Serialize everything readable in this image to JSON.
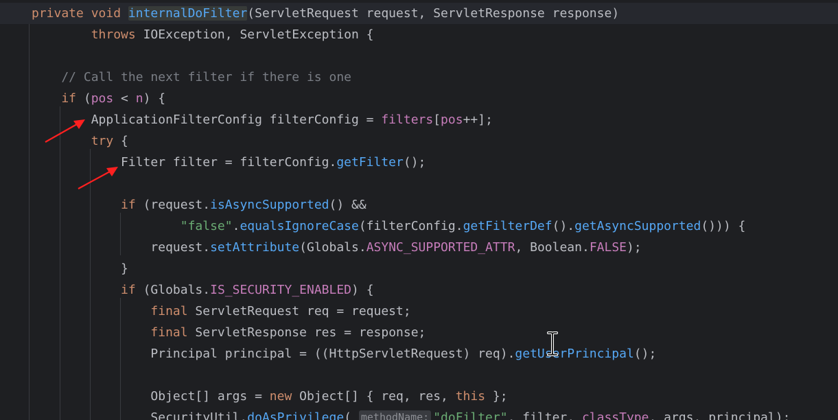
{
  "editor": {
    "lines": [
      {
        "id": "l1",
        "tokens": [
          {
            "t": "private void ",
            "c": "kw"
          },
          {
            "t": "internalDoFilter",
            "c": "fn hl-name"
          },
          {
            "t": "(ServletRequest ",
            "c": "ty"
          },
          {
            "t": "request",
            "c": "par"
          },
          {
            "t": ", ServletResponse ",
            "c": "ty"
          },
          {
            "t": "response",
            "c": "par"
          },
          {
            "t": ")",
            "c": "ty"
          }
        ]
      },
      {
        "id": "l2",
        "tokens": [
          {
            "t": "        throws ",
            "c": "kw"
          },
          {
            "t": "IOException, ServletException {",
            "c": "ty"
          }
        ]
      },
      {
        "id": "l3",
        "tokens": []
      },
      {
        "id": "l4",
        "tokens": [
          {
            "t": "    // Call the next filter if there is one",
            "c": "cm"
          }
        ]
      },
      {
        "id": "l5",
        "tokens": [
          {
            "t": "    if ",
            "c": "kw"
          },
          {
            "t": "(",
            "c": "ty"
          },
          {
            "t": "pos",
            "c": "pr"
          },
          {
            "t": " < ",
            "c": "ty"
          },
          {
            "t": "n",
            "c": "pr"
          },
          {
            "t": ") {",
            "c": "ty"
          }
        ]
      },
      {
        "id": "l6",
        "tokens": [
          {
            "t": "        ApplicationFilterConfig filterConfig = ",
            "c": "ty"
          },
          {
            "t": "filters",
            "c": "pr"
          },
          {
            "t": "[",
            "c": "ty"
          },
          {
            "t": "pos",
            "c": "pr"
          },
          {
            "t": "++];",
            "c": "ty"
          }
        ]
      },
      {
        "id": "l7",
        "tokens": [
          {
            "t": "        try ",
            "c": "kw"
          },
          {
            "t": "{",
            "c": "ty"
          }
        ]
      },
      {
        "id": "l8",
        "tokens": [
          {
            "t": "            Filter filter = filterConfig.",
            "c": "ty"
          },
          {
            "t": "getFilter",
            "c": "fn"
          },
          {
            "t": "();",
            "c": "ty"
          }
        ]
      },
      {
        "id": "l9",
        "tokens": []
      },
      {
        "id": "l10",
        "tokens": [
          {
            "t": "            if ",
            "c": "kw"
          },
          {
            "t": "(",
            "c": "ty"
          },
          {
            "t": "request",
            "c": "par"
          },
          {
            "t": ".",
            "c": "ty"
          },
          {
            "t": "isAsyncSupported",
            "c": "fn"
          },
          {
            "t": "() &&",
            "c": "ty"
          }
        ]
      },
      {
        "id": "l11",
        "tokens": [
          {
            "t": "                    ",
            "c": "ty"
          },
          {
            "t": "\"false\"",
            "c": "str"
          },
          {
            "t": ".",
            "c": "ty"
          },
          {
            "t": "equalsIgnoreCase",
            "c": "fn"
          },
          {
            "t": "(filterConfig.",
            "c": "ty"
          },
          {
            "t": "getFilterDef",
            "c": "fn"
          },
          {
            "t": "().",
            "c": "ty"
          },
          {
            "t": "getAsyncSupported",
            "c": "fn"
          },
          {
            "t": "())) {",
            "c": "ty"
          }
        ]
      },
      {
        "id": "l12",
        "tokens": [
          {
            "t": "                ",
            "c": "ty"
          },
          {
            "t": "request",
            "c": "par"
          },
          {
            "t": ".",
            "c": "ty"
          },
          {
            "t": "setAttribute",
            "c": "fn"
          },
          {
            "t": "(Globals.",
            "c": "ty"
          },
          {
            "t": "ASYNC_SUPPORTED_ATTR",
            "c": "pr"
          },
          {
            "t": ", Boolean.",
            "c": "ty"
          },
          {
            "t": "FALSE",
            "c": "pr"
          },
          {
            "t": ");",
            "c": "ty"
          }
        ]
      },
      {
        "id": "l13",
        "tokens": [
          {
            "t": "            }",
            "c": "ty"
          }
        ]
      },
      {
        "id": "l14",
        "tokens": [
          {
            "t": "            if ",
            "c": "kw"
          },
          {
            "t": "(Globals.",
            "c": "ty"
          },
          {
            "t": "IS_SECURITY_ENABLED",
            "c": "pr"
          },
          {
            "t": ") {",
            "c": "ty"
          }
        ]
      },
      {
        "id": "l15",
        "tokens": [
          {
            "t": "                final ",
            "c": "kw"
          },
          {
            "t": "ServletRequest req = ",
            "c": "ty"
          },
          {
            "t": "request",
            "c": "par"
          },
          {
            "t": ";",
            "c": "ty"
          }
        ]
      },
      {
        "id": "l16",
        "tokens": [
          {
            "t": "                final ",
            "c": "kw"
          },
          {
            "t": "ServletResponse res = ",
            "c": "ty"
          },
          {
            "t": "response",
            "c": "par"
          },
          {
            "t": ";",
            "c": "ty"
          }
        ]
      },
      {
        "id": "l17",
        "tokens": [
          {
            "t": "                Principal principal = ((HttpServletRequest) req).",
            "c": "ty"
          },
          {
            "t": "getUserPrincipal",
            "c": "fn"
          },
          {
            "t": "();",
            "c": "ty"
          }
        ]
      },
      {
        "id": "l18",
        "tokens": []
      },
      {
        "id": "l19",
        "tokens": [
          {
            "t": "                Object[] args = ",
            "c": "ty"
          },
          {
            "t": "new ",
            "c": "kw"
          },
          {
            "t": "Object[] { req, res, ",
            "c": "ty"
          },
          {
            "t": "this ",
            "c": "kw"
          },
          {
            "t": "};",
            "c": "ty"
          }
        ]
      },
      {
        "id": "l20",
        "tokens": [
          {
            "t": "                SecurityUtil.",
            "c": "ty"
          },
          {
            "t": "doAsPrivilege",
            "c": "fn"
          },
          {
            "t": "( ",
            "c": "ty"
          },
          {
            "t": "methodName:",
            "hint": true
          },
          {
            "t": "\"doFilter\"",
            "c": "str"
          },
          {
            "t": ", filter, ",
            "c": "ty"
          },
          {
            "t": "classType",
            "c": "pr"
          },
          {
            "t": ", args, principal);",
            "c": "ty"
          }
        ]
      }
    ]
  },
  "annotations": {
    "arrow_color": "#ff2020"
  },
  "pointer": {
    "icon": "text-cursor-icon"
  }
}
